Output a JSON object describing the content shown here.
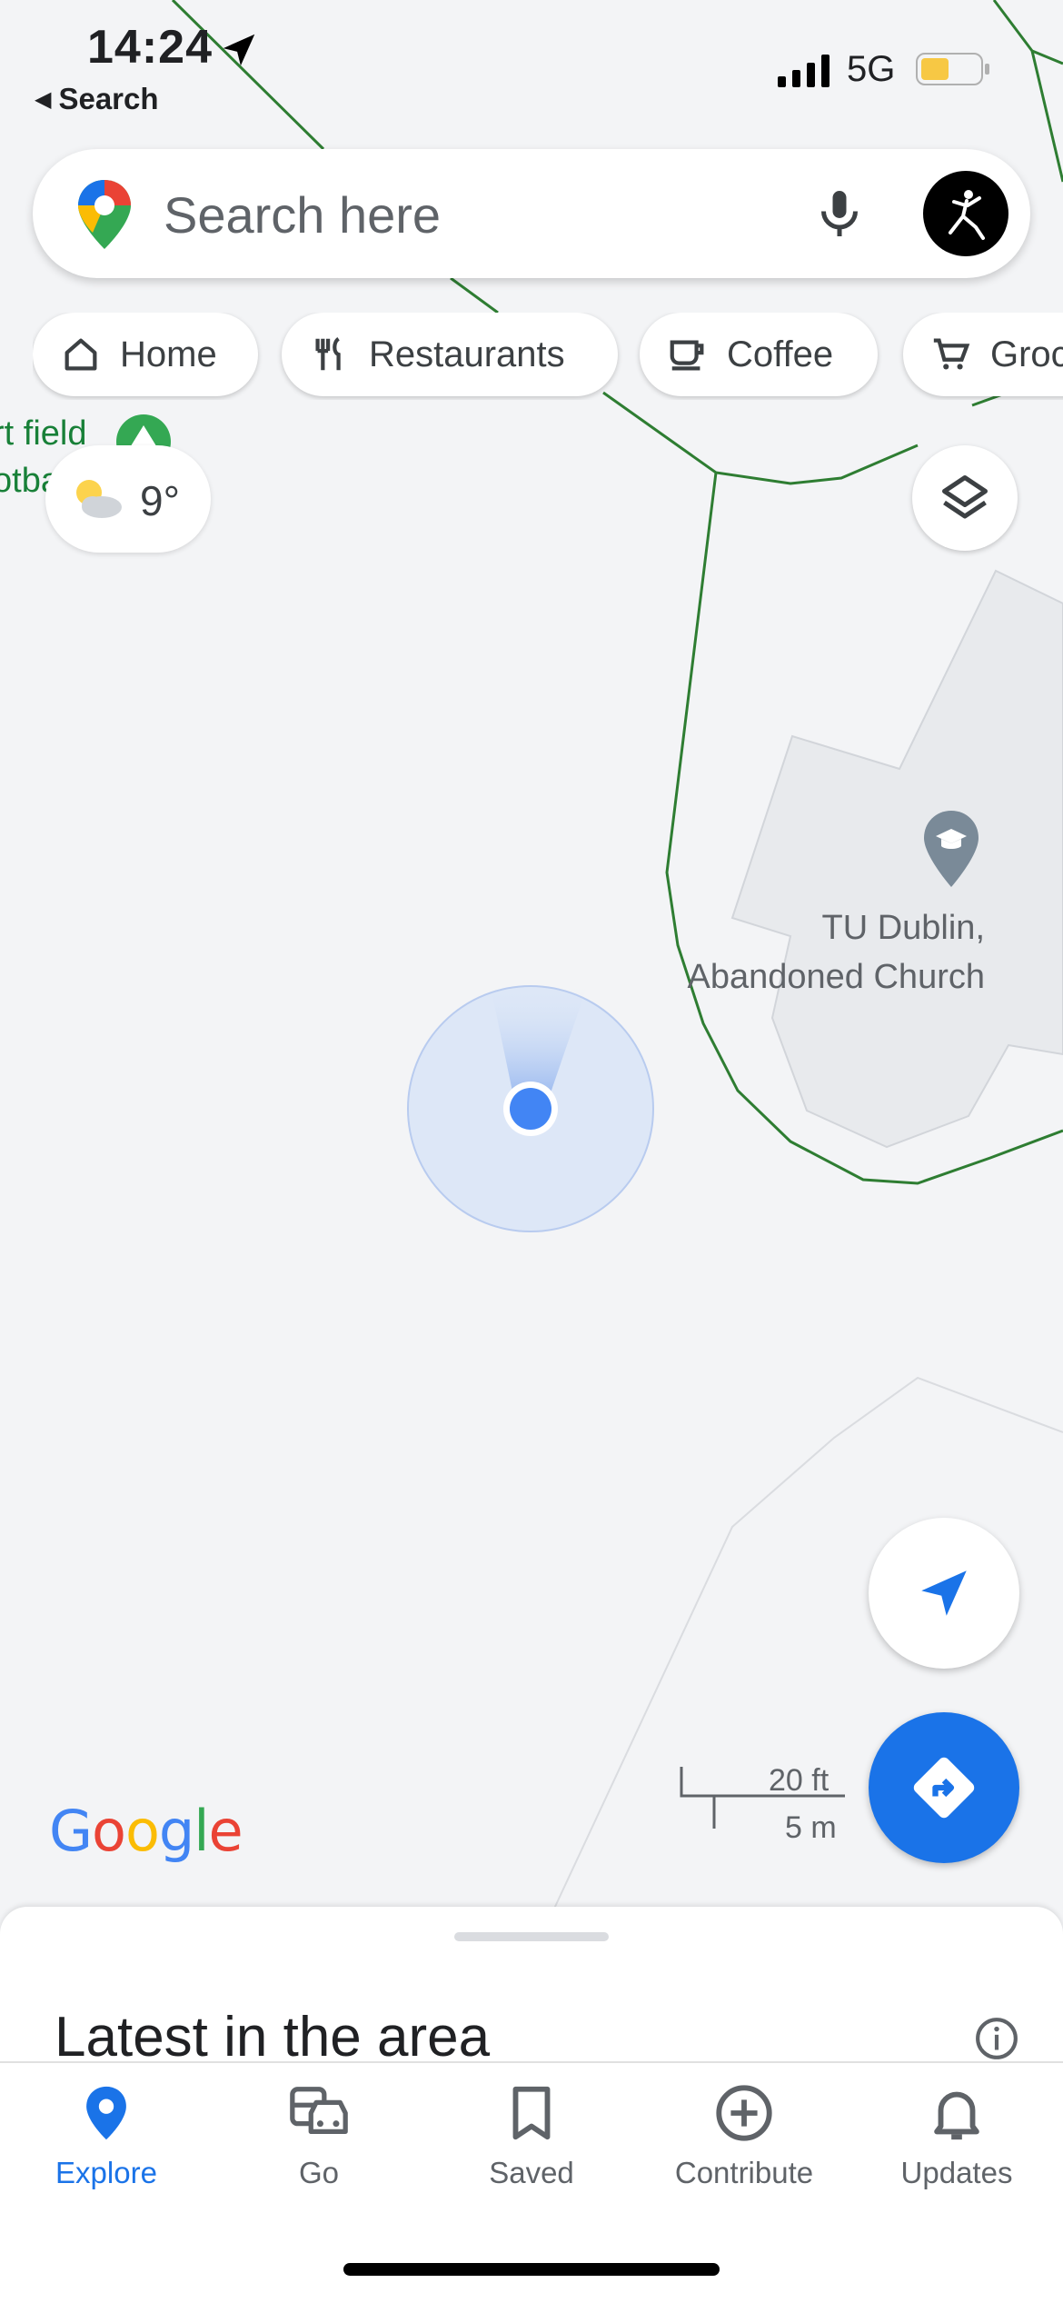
{
  "status_bar": {
    "time": "14:24",
    "back_label": "Search",
    "network": "5G"
  },
  "search": {
    "placeholder": "Search here"
  },
  "chips": [
    {
      "label": "Home",
      "icon": "home-icon"
    },
    {
      "label": "Restaurants",
      "icon": "restaurant-icon"
    },
    {
      "label": "Coffee",
      "icon": "coffee-icon"
    },
    {
      "label": "Groceries",
      "icon": "cart-icon"
    }
  ],
  "map": {
    "weather_temp": "9°",
    "partial_label_1": "rt field",
    "partial_label_2": "otba",
    "poi_label_line1": "TU Dublin,",
    "poi_label_line2": "Abandoned Church",
    "scale_imperial": "20 ft",
    "scale_metric": "5 m",
    "brand": "Google"
  },
  "sheet": {
    "title": "Latest in the area"
  },
  "tabs": [
    {
      "label": "Explore",
      "icon": "explore-pin-icon",
      "active": true
    },
    {
      "label": "Go",
      "icon": "commute-icon"
    },
    {
      "label": "Saved",
      "icon": "bookmark-icon"
    },
    {
      "label": "Contribute",
      "icon": "add-circle-icon"
    },
    {
      "label": "Updates",
      "icon": "bell-icon"
    }
  ],
  "colors": {
    "accent": "#1a73e8",
    "map_background": "#f3f4f6",
    "boundary_green": "#2e7d32"
  }
}
